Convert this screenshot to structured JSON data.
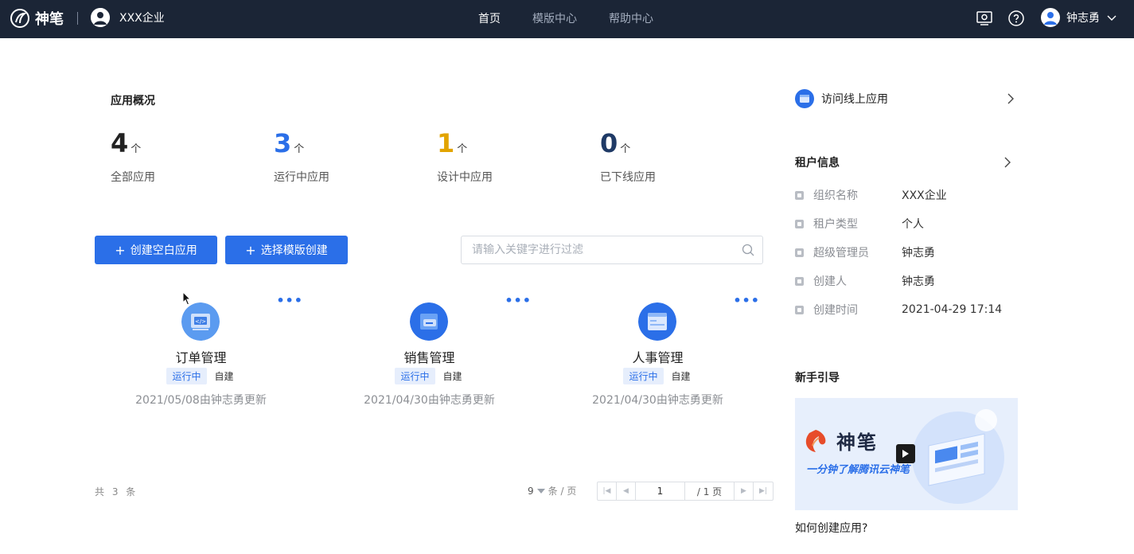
{
  "topbar": {
    "brand": "神笔",
    "company": "XXX企业",
    "nav": [
      "首页",
      "模版中心",
      "帮助中心"
    ],
    "user": "钟志勇"
  },
  "overview": {
    "title": "应用概况",
    "stats": [
      {
        "value": "4",
        "unit": "个",
        "label": "全部应用",
        "color": "#222222"
      },
      {
        "value": "3",
        "unit": "个",
        "label": "运行中应用",
        "color": "#2b6fe8"
      },
      {
        "value": "1",
        "unit": "个",
        "label": "设计中应用",
        "color": "#e2a400"
      },
      {
        "value": "0",
        "unit": "个",
        "label": "已下线应用",
        "color": "#1f3a66"
      }
    ]
  },
  "actions": {
    "create_blank": "创建空白应用",
    "create_from_template": "选择模版创建",
    "search_placeholder": "请输入关键字进行过滤"
  },
  "apps": [
    {
      "name": "订单管理",
      "status": "运行中",
      "source": "自建",
      "updated": "2021/05/08由钟志勇更新",
      "icon": "order-app-icon"
    },
    {
      "name": "销售管理",
      "status": "运行中",
      "source": "自建",
      "updated": "2021/04/30由钟志勇更新",
      "icon": "sales-app-icon"
    },
    {
      "name": "人事管理",
      "status": "运行中",
      "source": "自建",
      "updated": "2021/04/30由钟志勇更新",
      "icon": "hr-app-icon"
    }
  ],
  "pagination": {
    "total": "共 3 条",
    "page_size": "9",
    "per_page_label": "条 / 页",
    "current_page": "1",
    "total_pages": "/ 1 页"
  },
  "sidebar": {
    "visit_online": "访问线上应用",
    "tenant_title": "租户信息",
    "tenant": [
      {
        "key": "组织名称",
        "value": "XXX企业"
      },
      {
        "key": "租户类型",
        "value": "个人"
      },
      {
        "key": "超级管理员",
        "value": "钟志勇"
      },
      {
        "key": "创建人",
        "value": "钟志勇"
      },
      {
        "key": "创建时间",
        "value": "2021-04-29 17:14"
      }
    ],
    "guide_title": "新手引导",
    "banner_brand": "神笔",
    "banner_slogan": "一分钟了解腾讯云神笔",
    "guide_caption": "如何创建应用?"
  },
  "colors": {
    "accent": "#2b6fe8",
    "topbar": "#1b2536"
  }
}
